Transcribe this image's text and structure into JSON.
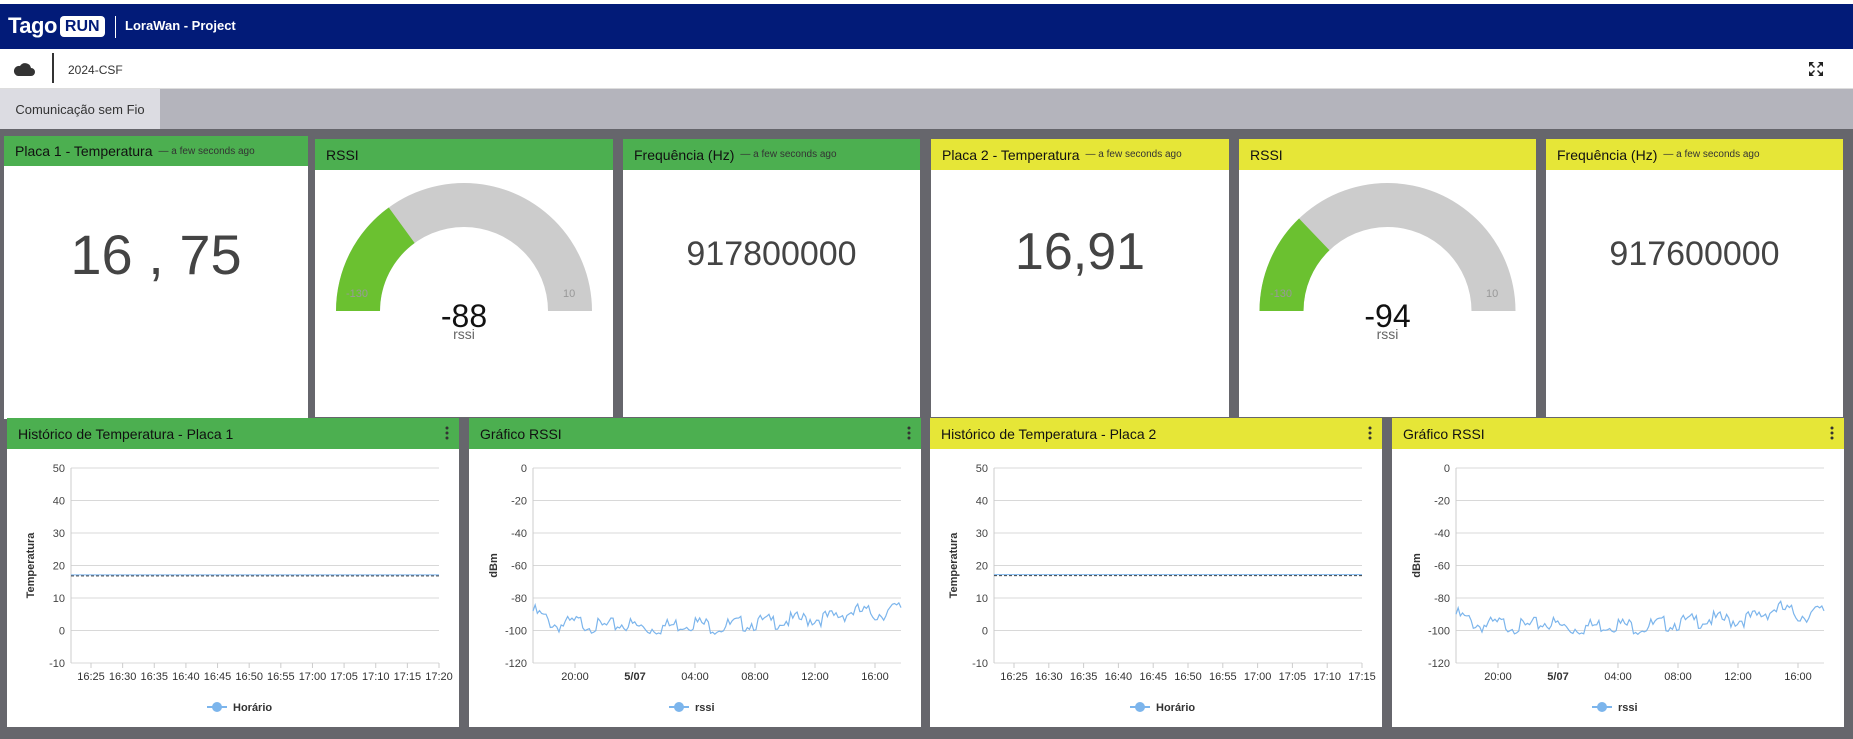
{
  "app": {
    "logo_text": "Tago",
    "logo_badge": "RUN",
    "title": "LoraWan - Project"
  },
  "subbar": {
    "dashboard_name": "2024-CSF"
  },
  "tabs": [
    {
      "label": "Comunicação sem Fio",
      "active": true
    }
  ],
  "widgets": {
    "temp1": {
      "title": "Placa 1 - Temperatura",
      "updated": "— a few seconds ago",
      "value": "16 , 75",
      "color": "#4caf50"
    },
    "rssi1": {
      "title": "RSSI",
      "value": "-88",
      "unit": "rssi",
      "min": "-130",
      "max": "10",
      "color": "#4caf50"
    },
    "freq1": {
      "title": "Frequência (Hz)",
      "updated": "— a few seconds ago",
      "value": "917800000",
      "color": "#4caf50"
    },
    "temp2": {
      "title": "Placa 2 - Temperatura",
      "updated": "— a few seconds ago",
      "value": "16,91",
      "color": "#e6e637"
    },
    "rssi2": {
      "title": "RSSI",
      "value": "-94",
      "unit": "rssi",
      "min": "-130",
      "max": "10",
      "color": "#e6e637"
    },
    "freq2": {
      "title": "Frequência (Hz)",
      "updated": "— a few seconds ago",
      "value": "917600000",
      "color": "#e6e637"
    }
  },
  "charts": {
    "hist1": {
      "title": "Histórico de Temperatura - Placa 1"
    },
    "rssiChart1": {
      "title": "Gráfico RSSI"
    },
    "hist2": {
      "title": "Histórico de Temperatura - Placa 2"
    },
    "rssiChart2": {
      "title": "Gráfico RSSI"
    }
  },
  "chart_data": [
    {
      "type": "line",
      "ylabel": "Temperatura",
      "ylim": [
        -10,
        50
      ],
      "yticks": [
        "50",
        "40",
        "30",
        "20",
        "10",
        "0",
        "-10"
      ],
      "categories": [
        "16:25",
        "16:30",
        "16:35",
        "16:40",
        "16:45",
        "16:50",
        "16:55",
        "17:00",
        "17:05",
        "17:10",
        "17:15",
        "17:20"
      ],
      "series": [
        {
          "name": "Horário",
          "values": [
            16.8,
            16.8,
            16.8,
            16.8,
            16.8,
            16.8,
            16.8,
            16.8,
            16.8,
            16.8,
            16.8,
            16.8
          ]
        }
      ]
    },
    {
      "type": "line",
      "ylabel": "dBm",
      "ylim": [
        -120,
        0
      ],
      "yticks": [
        "0",
        "-20",
        "-40",
        "-60",
        "-80",
        "-100",
        "-120"
      ],
      "categories": [
        "20:00",
        "5/07",
        "04:00",
        "08:00",
        "12:00",
        "16:00"
      ],
      "series": [
        {
          "name": "rssi",
          "values": [
            -88,
            -97,
            -95,
            -98,
            -96,
            -99,
            -97,
            -95,
            -98,
            -96,
            -95,
            -94,
            -93,
            -92,
            -88,
            -90,
            -86
          ]
        }
      ]
    },
    {
      "type": "line",
      "ylabel": "Temperatura",
      "ylim": [
        -10,
        50
      ],
      "yticks": [
        "50",
        "40",
        "30",
        "20",
        "10",
        "0",
        "-10"
      ],
      "categories": [
        "16:25",
        "16:30",
        "16:35",
        "16:40",
        "16:45",
        "16:50",
        "16:55",
        "17:00",
        "17:05",
        "17:10",
        "17:15"
      ],
      "series": [
        {
          "name": "Horário",
          "values": [
            16.9,
            16.9,
            16.9,
            16.9,
            16.9,
            16.9,
            16.9,
            16.9,
            16.9,
            16.9,
            16.9
          ]
        }
      ]
    },
    {
      "type": "line",
      "ylabel": "dBm",
      "ylim": [
        -120,
        0
      ],
      "yticks": [
        "0",
        "-20",
        "-40",
        "-60",
        "-80",
        "-100",
        "-120"
      ],
      "categories": [
        "20:00",
        "5/07",
        "04:00",
        "08:00",
        "12:00",
        "16:00"
      ],
      "series": [
        {
          "name": "rssi",
          "values": [
            -90,
            -97,
            -96,
            -98,
            -95,
            -99,
            -97,
            -96,
            -98,
            -96,
            -95,
            -93,
            -94,
            -92,
            -86,
            -91,
            -88
          ]
        }
      ]
    }
  ]
}
